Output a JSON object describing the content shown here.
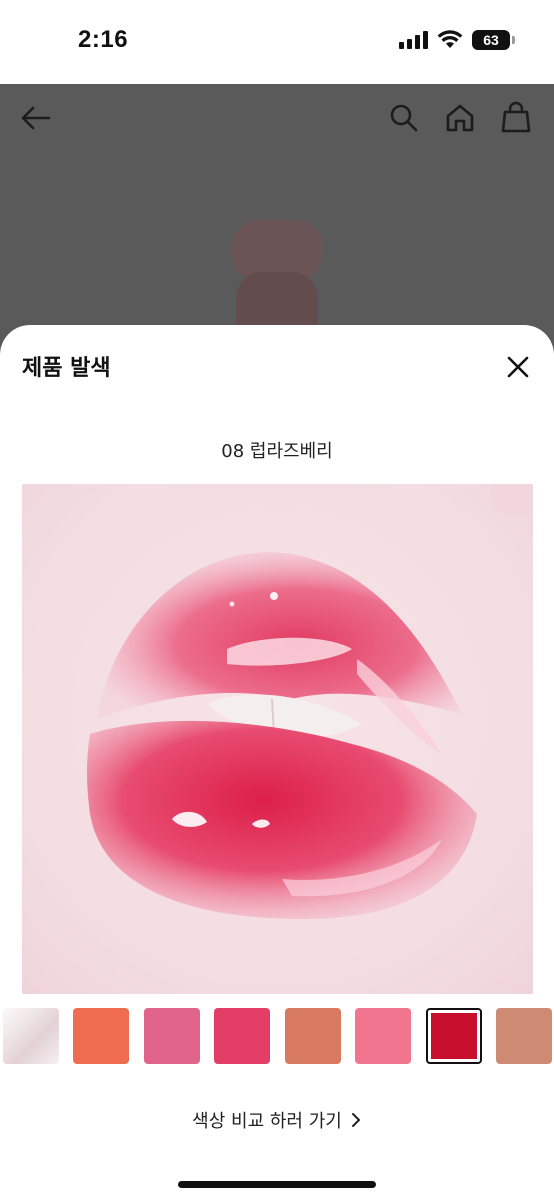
{
  "status_bar": {
    "time": "2:16",
    "battery": "63",
    "icons": [
      "cellular-signal-icon",
      "wifi-icon",
      "battery-icon"
    ]
  },
  "background_page": {
    "icons": [
      "back-arrow-icon",
      "search-icon",
      "home-icon",
      "shopping-bag-icon"
    ]
  },
  "sheet": {
    "title": "제품 발색",
    "close_icon": "close-icon",
    "shade_name": "08 럽라즈베리",
    "swatch_colors": [
      "#ece0e3",
      "#ee6c50",
      "#e0648b",
      "#e23e66",
      "#d87a60",
      "#f2758f",
      "#c8102e",
      "#cf8a74"
    ],
    "selected_swatch_index": 6,
    "compare_link": "색상 비교 하러 가기",
    "compare_icon": "chevron-right-icon"
  }
}
